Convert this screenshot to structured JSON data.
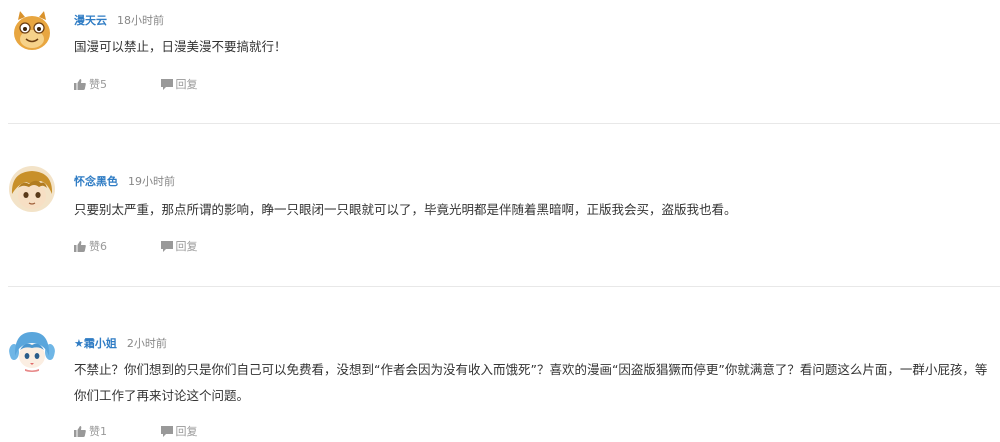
{
  "comments": [
    {
      "username": "漫天云",
      "time": "18小时前",
      "text": "国漫可以禁止，日漫美漫不要搞就行！",
      "like_label": "赞5",
      "reply_label": "回复"
    },
    {
      "username": "怀念黑色",
      "time": "19小时前",
      "text": "只要别太严重，那点所谓的影响，睁一只眼闭一只眼就可以了，毕竟光明都是伴随着黑暗啊，正版我会买，盗版我也看。",
      "like_label": "赞6",
      "reply_label": "回复"
    },
    {
      "username": "★霜小姐",
      "time": "2小时前",
      "text": "不禁止？你们想到的只是你们自己可以免费看，没想到“作者会因为没有收入而饿死”？喜欢的漫画“因盗版猖獗而停更”你就满意了？看问题这么片面，一群小屁孩，等你们工作了再来讨论这个问题。",
      "like_label": "赞1",
      "reply_label": "回复"
    }
  ],
  "colors": {
    "username": "#2f7cc4",
    "meta": "#888888",
    "action": "#999999",
    "divider": "#e8e8e8"
  },
  "icons": {
    "like": "thumbs-up-icon",
    "reply": "speech-bubble-icon"
  }
}
